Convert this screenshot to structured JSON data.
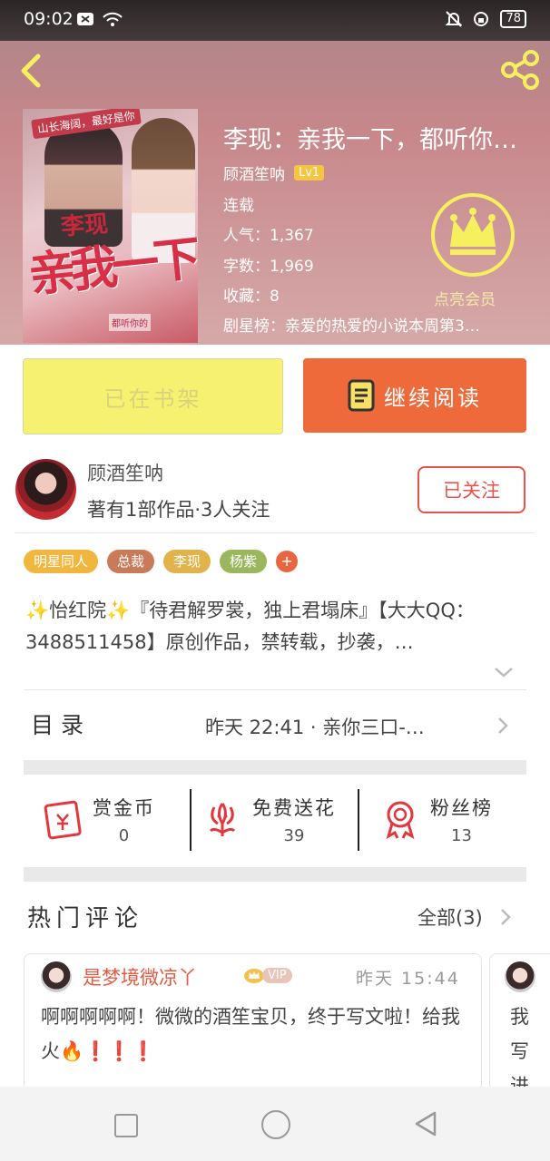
{
  "status": {
    "time": "09:02",
    "battery": "78"
  },
  "book": {
    "title": "李现：亲我一下，都听你…",
    "author": "顾酒笙呐",
    "level": "Lv1",
    "state": "连载",
    "popularity": "人气：1,367",
    "words": "字数：1,969",
    "favorites": "收藏：8",
    "rank": "剧星榜：亲爱的热爱的小说本周第3…",
    "cover": {
      "top_banner": "山长海阔，最好是你",
      "title_small": "李现",
      "title_big": "亲我一下",
      "bottom_text": "都听你的"
    }
  },
  "vip": {
    "label": "点亮会员"
  },
  "buttons": {
    "shelf": "已在书架",
    "read": "继续阅读"
  },
  "author_info": {
    "name": "顾酒笙呐",
    "sub": "著有1部作品·3人关注",
    "follow": "已关注"
  },
  "tags": [
    {
      "label": "明星同人",
      "color": "#f0b63e"
    },
    {
      "label": "总裁",
      "color": "#c97a59"
    },
    {
      "label": "李现",
      "color": "#e2b24b"
    },
    {
      "label": "杨紫",
      "color": "#9ab75d"
    }
  ],
  "tag_more": "+",
  "description": "✨怡红院✨『待君解罗裳，独上君塌床』【大大QQ：3488511458】原创作品，禁转载，抄袭，…",
  "toc": {
    "label": "目录",
    "latest": "昨天 22:41 · 亲你三口-…"
  },
  "stats": [
    {
      "label": "赏金币",
      "value": "0"
    },
    {
      "label": "免费送花",
      "value": "39"
    },
    {
      "label": "粉丝榜",
      "value": "13"
    }
  ],
  "comments": {
    "title": "热门评论",
    "all": "全部(3)",
    "items": [
      {
        "user": "是梦境微凉丫",
        "badge": "VIP",
        "time": "昨天 15:44",
        "text": "啊啊啊啊啊！微微的酒笙宝贝，终于写文啦！给我火🔥❗❗❗"
      },
      {
        "preview": "我写进"
      }
    ]
  }
}
